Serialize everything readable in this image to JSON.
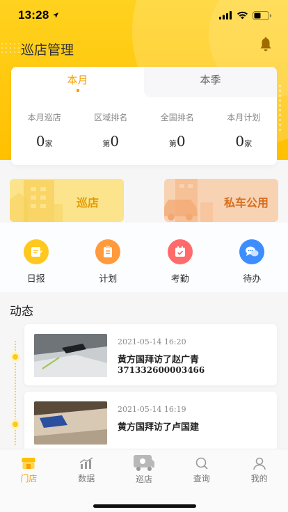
{
  "status_bar": {
    "time": "13:28"
  },
  "header": {
    "title": "巡店管理"
  },
  "stats_card": {
    "tabs": [
      {
        "label": "本月",
        "active": true
      },
      {
        "label": "本季",
        "active": false
      }
    ],
    "stats": [
      {
        "label": "本月巡店",
        "prefix": "",
        "value": "0",
        "unit": "家"
      },
      {
        "label": "区域排名",
        "prefix": "第",
        "value": "0",
        "unit": ""
      },
      {
        "label": "全国排名",
        "prefix": "第",
        "value": "0",
        "unit": ""
      },
      {
        "label": "本月计划",
        "prefix": "",
        "value": "0",
        "unit": "家"
      }
    ]
  },
  "tiles": [
    {
      "label": "巡店",
      "icon": "building-icon"
    },
    {
      "label": "私车公用",
      "icon": "car-icon"
    }
  ],
  "quick_actions": [
    {
      "label": "日报",
      "icon": "daily-report-icon",
      "color": "#ffc81e"
    },
    {
      "label": "计划",
      "icon": "plan-icon",
      "color": "#ff9a3d"
    },
    {
      "label": "考勤",
      "icon": "attendance-icon",
      "color": "#ff6b6b"
    },
    {
      "label": "待办",
      "icon": "todo-icon",
      "color": "#3d8dff"
    }
  ],
  "feed": {
    "title": "动态",
    "items": [
      {
        "time": "2021-05-14 16:20",
        "title": "黄方国拜访了赵广青",
        "subtitle": "371332600003466"
      },
      {
        "time": "2021-05-14 16:19",
        "title": "黄方国拜访了卢国建",
        "subtitle": ""
      }
    ]
  },
  "tab_bar": {
    "items": [
      {
        "label": "门店",
        "icon": "store-icon",
        "active": true
      },
      {
        "label": "数据",
        "icon": "chart-icon",
        "active": false
      },
      {
        "label": "巡店",
        "icon": "patrol-van-icon",
        "active": false
      },
      {
        "label": "查询",
        "icon": "search-icon",
        "active": false
      },
      {
        "label": "我的",
        "icon": "profile-icon",
        "active": false
      }
    ]
  },
  "colors": {
    "brand_yellow": "#ffc000",
    "accent_orange": "#f5a000"
  }
}
